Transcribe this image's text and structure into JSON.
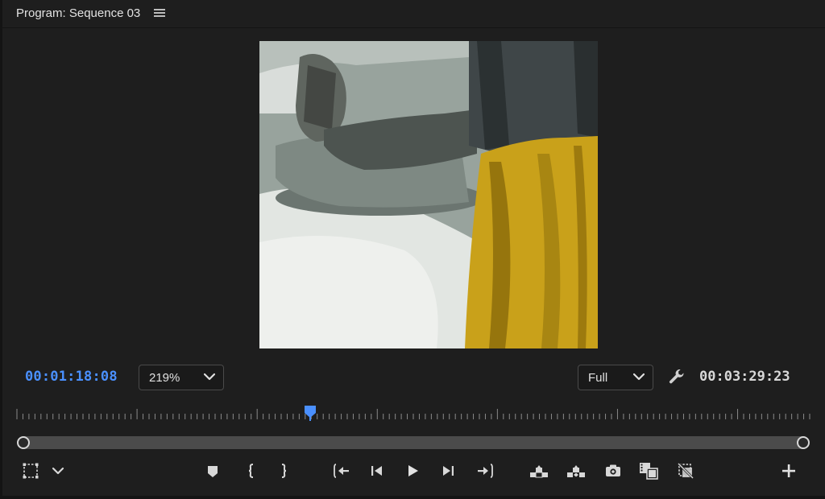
{
  "panel": {
    "title": "Program: Sequence 03",
    "menu_icon": "hamburger-icon"
  },
  "timecodes": {
    "current": "00:01:18:08",
    "duration": "00:03:29:23"
  },
  "zoom_dropdown": {
    "value": "219%"
  },
  "resolution_dropdown": {
    "value": "Full"
  },
  "playback": {
    "playhead_position": 0.368,
    "colors": {
      "accent": "#4a90ff",
      "background": "#1e1e1e"
    }
  },
  "toolbar": {
    "buttons": [
      "safe-margins-icon",
      "chevron-down-icon",
      "add-marker-icon",
      "mark-in-icon",
      "mark-out-icon",
      "go-to-in-icon",
      "step-back-icon",
      "play-icon",
      "step-forward-icon",
      "go-to-out-icon",
      "lift-icon",
      "extract-icon",
      "export-frame-icon",
      "comparison-view-icon",
      "proxy-toggle-icon",
      "plus-icon"
    ]
  }
}
